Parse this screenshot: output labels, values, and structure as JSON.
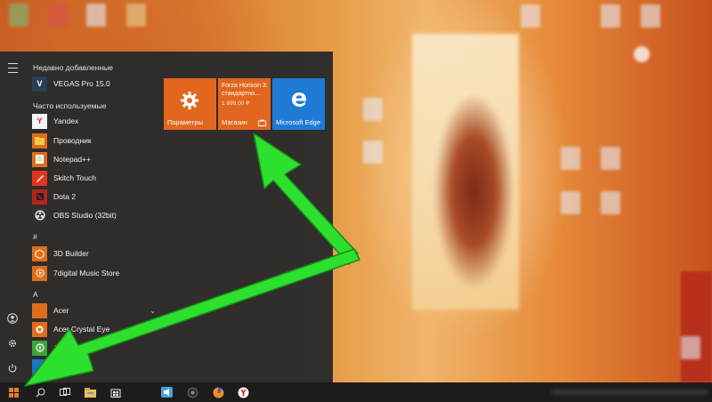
{
  "start_menu": {
    "sections": {
      "recent": "Недавно добавленные",
      "frequent": "Часто используемые",
      "hash": "#",
      "a": "A"
    },
    "apps": {
      "vegas": "VEGAS Pro 15.0",
      "yandex": "Yandex",
      "explorer": "Проводник",
      "notepad": "Notepad++",
      "skitch": "Skitch Touch",
      "dota": "Dota 2",
      "obs": "OBS Studio (32bit)",
      "builder": "3D Builder",
      "sevendigital": "7digital Music Store",
      "acer": "Acer",
      "acer_eye": "Acer Crystal Eye",
      "acer_explorer": "Acer Explorer"
    },
    "tiles": {
      "settings_label": "Параметры",
      "store_title": "Forza Horizon 3: стандартно...",
      "store_price": "1 999,00 ₽",
      "store_label": "Магазин",
      "edge_label": "Microsoft Edge"
    }
  },
  "colors": {
    "accent_tile": "#e3661f",
    "edge_tile": "#1f7ad4",
    "arrow": "#2de02d",
    "menu_bg": "#2a2a2a",
    "taskbar_bg": "#1c1c1c"
  },
  "icons": {
    "rail": [
      "hamburger-icon",
      "user-icon",
      "gear-icon",
      "power-icon"
    ],
    "taskbar": [
      "windows-start-icon",
      "search-icon",
      "task-view-icon",
      "file-explorer-icon",
      "store-icon",
      "media-icon",
      "obs-icon",
      "firefox-icon",
      "yandex-icon"
    ]
  }
}
